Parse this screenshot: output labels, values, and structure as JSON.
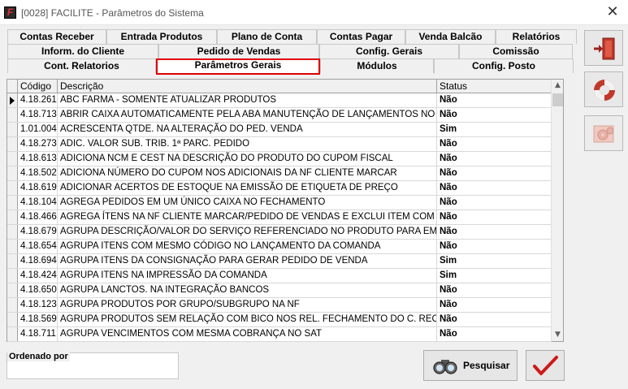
{
  "window": {
    "title": "[0028] FACILITE - Parâmetros do Sistema",
    "app_icon_letter": "F",
    "close_glyph": "✕"
  },
  "tabs": {
    "row1": [
      "Contas Receber",
      "Entrada Produtos",
      "Plano de Conta",
      "Contas Pagar",
      "Venda Balcão",
      "Relatórios"
    ],
    "row2": [
      "Inform. do Cliente",
      "Pedido de Vendas",
      "Config. Gerais",
      "Comissão"
    ],
    "row3": [
      "Cont. Relatorios",
      "Parâmetros Gerais",
      "Módulos",
      "Config. Posto"
    ],
    "active": "Parâmetros Gerais"
  },
  "grid": {
    "columns": {
      "code": "Código",
      "description": "Descrição",
      "status": "Status"
    },
    "rows": [
      {
        "code": "4.18.261",
        "description": "ABC FARMA - SOMENTE ATUALIZAR PRODUTOS",
        "status": "Não"
      },
      {
        "code": "4.18.713",
        "description": "ABRIR CAIXA AUTOMATICAMENTE PELA ABA MANUTENÇÃO DE LANÇAMENTOS NO MÓDULO",
        "status": "Não"
      },
      {
        "code": "1.01.004",
        "description": "ACRESCENTA QTDE. NA ALTERAÇÃO DO PED. VENDA",
        "status": "Sim"
      },
      {
        "code": "4.18.273",
        "description": "ADIC. VALOR SUB. TRIB. 1ª PARC. PEDIDO",
        "status": "Não"
      },
      {
        "code": "4.18.613",
        "description": "ADICIONA NCM E CEST NA DESCRIÇÃO DO PRODUTO DO CUPOM FISCAL",
        "status": "Não"
      },
      {
        "code": "4.18.502",
        "description": "ADICIONA NÚMERO DO CUPOM NOS ADICIONAIS DA NF CLIENTE MARCAR",
        "status": "Não"
      },
      {
        "code": "4.18.619",
        "description": "ADICIONAR ACERTOS DE ESTOQUE NA EMISSÃO DE ETIQUETA DE PREÇO",
        "status": "Não"
      },
      {
        "code": "4.18.104",
        "description": "AGREGA PEDIDOS EM UM ÚNICO CAIXA NO FECHAMENTO",
        "status": "Não"
      },
      {
        "code": "4.18.466",
        "description": "AGREGA ÍTENS NA NF CLIENTE MARCAR/PEDIDO DE VENDAS E EXCLUI ITEM COM QUANTIDADE",
        "status": "Não"
      },
      {
        "code": "4.18.679",
        "description": "AGRUPA DESCRIÇÃO/VALOR DO SERVIÇO REFERENCIADO NO PRODUTO PARA EMISSÃO",
        "status": "Não"
      },
      {
        "code": "4.18.654",
        "description": "AGRUPA ITENS COM MESMO CÓDIGO NO LANÇAMENTO DA COMANDA",
        "status": "Não"
      },
      {
        "code": "4.18.694",
        "description": "AGRUPA ITENS DA CONSIGNAÇÃO PARA GERAR PEDIDO DE VENDA",
        "status": "Sim"
      },
      {
        "code": "4.18.424",
        "description": "AGRUPA ITENS NA IMPRESSÃO DA COMANDA",
        "status": "Sim"
      },
      {
        "code": "4.18.650",
        "description": "AGRUPA LANCTOS. NA INTEGRAÇÃO BANCOS",
        "status": "Não"
      },
      {
        "code": "4.18.123",
        "description": "AGRUPA PRODUTOS POR GRUPO/SUBGRUPO NA NF",
        "status": "Não"
      },
      {
        "code": "4.18.569",
        "description": "AGRUPA PRODUTOS SEM RELAÇÃO COM BICO NOS REL. FECHAMENTO DO C. RECEBER",
        "status": "Não"
      },
      {
        "code": "4.18.711",
        "description": "AGRUPA VENCIMENTOS COM MESMA COBRANÇA NO SAT",
        "status": "Não"
      }
    ]
  },
  "footer": {
    "ordered_by_label": "Ordenado por",
    "ordered_by_value": "",
    "search_button": "Pesquisar"
  }
}
